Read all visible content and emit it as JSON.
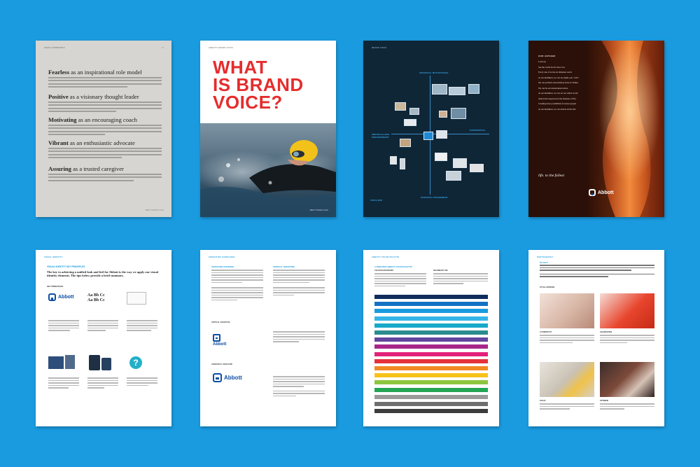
{
  "pages": {
    "p1": {
      "header": "VOICE ATTRIBUTES",
      "page_number": "13",
      "footer": "ABBOTT BRAND VOICE",
      "items": [
        {
          "bold": "Fearless",
          "rest": " as an inspirational role model"
        },
        {
          "bold": "Positive",
          "rest": " as a visionary thought leader"
        },
        {
          "bold": "Motivating",
          "rest": " as an encouraging coach"
        },
        {
          "bold": "Vibrant",
          "rest": " as an enthusiastic advocate"
        },
        {
          "bold": "Assuring",
          "rest": " as a trusted caregiver"
        }
      ]
    },
    "p2": {
      "headline_line1": "WHAT",
      "headline_line2": "IS BRAND",
      "headline_line3": "VOICE?",
      "header": "ABBOTT BRAND VOICE",
      "footer": "ABBOTT BRAND VOICE"
    },
    "p3": {
      "header": "BRAND VOICE",
      "label_top": "UNIVERSAL MOTIVATIONAL",
      "label_left": "INDIVIDUALIZED EMPOWERMENT",
      "label_right": "EXPERIENTIAL",
      "label_bottom": "SCIENTIFIC REFINEMENT",
      "foot": "VOICE MAP"
    },
    "p4": {
      "header": "OUR ANTHEM",
      "lines": [
        "Look up.",
        "See the world not for how it is,",
        "but for how it could be.",
        "Every one of us has an immense reach.",
        "At our healthiest, we can see sights you \"can't\"",
        "Healthy, we are capable of so much more.",
        "We can perform extraordinary feats of vitality.",
        "Live in full color.",
        "We can be our unrestrained selves.",
        "Unlimited. Unstoppable.",
        "At our healthiest, we can set our whole world",
        "We can make possibilities a reality.",
        "Abbott has long been in the business of life.",
        "Creating more possibilities for more people",
        "At our healthiest, we can unlock all the life",
        "has to offer."
      ],
      "tagline": "life. to the fullest",
      "logo": "Abbott"
    },
    "p5": {
      "header": "VISUAL IDENTITY",
      "title": "VISUAL IDENTITY KEY PRINCIPLES",
      "lead": "The key to achieving a unified look and feel for Abbott is the way we apply our visual identity elements. The tips below provide a brief summary.",
      "section": "KEY PRINCIPLES",
      "logo": "Abbott",
      "type_sample": "Aa Bb Cc\nAa Bb Cc"
    },
    "p6": {
      "header": "SIGNATURE GUIDELINES",
      "col1_title": "SIGNATURE OVERVIEW",
      "col2_title": "VERTICAL SIGNATURE",
      "sub1": "VERTICAL SIGNATURE",
      "sub2": "HORIZONTAL SIGNATURE",
      "logo": "Abbott"
    },
    "p7": {
      "header": "ABBOTT COLOR PALETTE",
      "title": "A BRIGHTER ABBOTT COLOR PALETTE",
      "col_a": "COLOR BACKGROUND",
      "col_b": "SECONDARY USE",
      "swatches": [
        "#0f2d5c",
        "#1372c4",
        "#1a9be0",
        "#35b5e8",
        "#18a9c9",
        "#2b8c8f",
        "#63469e",
        "#a7278a",
        "#e3237b",
        "#e5323a",
        "#f18a22",
        "#f6c31a",
        "#8dc63f",
        "#23a553",
        "#9a9a9a",
        "#6e6e6e",
        "#3c3c3c"
      ]
    },
    "p8": {
      "header": "PHOTOGRAPHY",
      "lead_title": "IN LIGHT",
      "section": "STYLE CRITERIA",
      "cap1": "AUTHENTICITY",
      "cap2": "CELEBRATION",
      "cap3": "FOCUS",
      "cap4": "OPTIMISM"
    }
  }
}
